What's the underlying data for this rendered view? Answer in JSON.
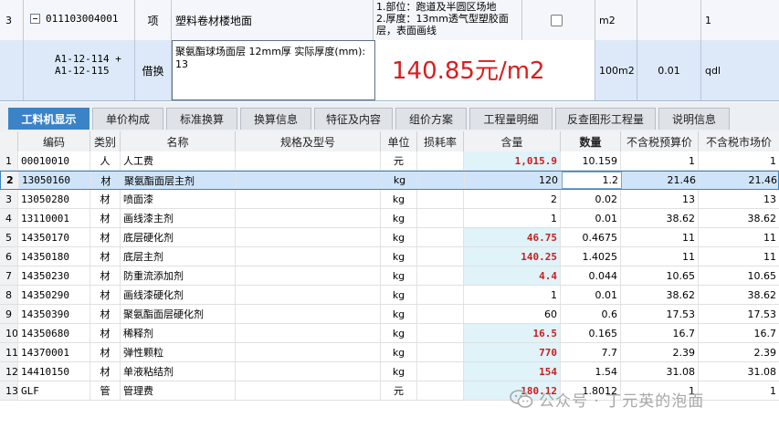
{
  "top_rows": [
    {
      "rownum": "3",
      "code": "011103004001",
      "type": "项",
      "name": "塑料卷材楼地面",
      "feature_lines": [
        "1.部位：跑道及半圆区场地",
        "2.厚度：13mm透气型塑胶面",
        "层，表面画线"
      ],
      "unit": "m2",
      "quantity": "1"
    },
    {
      "code_lines": [
        "A1-12-114 +",
        "A1-12-115"
      ],
      "type": "借换",
      "name_lines": [
        "聚氨酯球场面层 12mm厚  实际厚度(mm):",
        "13"
      ],
      "price": "140.85元/m2",
      "unit": "100m2",
      "quantity": "0.01",
      "extra": "qdl"
    }
  ],
  "tabs": [
    {
      "label": "工料机显示",
      "active": true
    },
    {
      "label": "单价构成"
    },
    {
      "label": "标准换算"
    },
    {
      "label": "换算信息"
    },
    {
      "label": "特征及内容"
    },
    {
      "label": "组价方案"
    },
    {
      "label": "工程量明细"
    },
    {
      "label": "反查图形工程量"
    },
    {
      "label": "说明信息"
    }
  ],
  "columns": {
    "code": "编码",
    "category": "类别",
    "name": "名称",
    "spec": "规格及型号",
    "unit": "单位",
    "loss": "损耗率",
    "content": "含量",
    "quantity": "数量",
    "budget_price": "不含税预算价",
    "market_price": "不含税市场价"
  },
  "rows": [
    {
      "n": "1",
      "code": "00010010",
      "cat": "人",
      "name": "人工费",
      "unit": "元",
      "content": "1,015.9",
      "content_red": true,
      "qty": "10.159",
      "bp": "1",
      "mp": "1"
    },
    {
      "n": "2",
      "code": "13050160",
      "cat": "材",
      "name": "聚氨酯面层主剂",
      "unit": "kg",
      "content": "120",
      "content_red": false,
      "qty": "1.2",
      "bp": "21.46",
      "mp": "21.46",
      "selected": true
    },
    {
      "n": "3",
      "code": "13050280",
      "cat": "材",
      "name": "喷面漆",
      "unit": "kg",
      "content": "2",
      "content_red": false,
      "qty": "0.02",
      "bp": "13",
      "mp": "13"
    },
    {
      "n": "4",
      "code": "13110001",
      "cat": "材",
      "name": "画线漆主剂",
      "unit": "kg",
      "content": "1",
      "content_red": false,
      "qty": "0.01",
      "bp": "38.62",
      "mp": "38.62"
    },
    {
      "n": "5",
      "code": "14350170",
      "cat": "材",
      "name": "底层硬化剂",
      "unit": "kg",
      "content": "46.75",
      "content_red": true,
      "qty": "0.4675",
      "bp": "11",
      "mp": "11"
    },
    {
      "n": "6",
      "code": "14350180",
      "cat": "材",
      "name": "底层主剂",
      "unit": "kg",
      "content": "140.25",
      "content_red": true,
      "qty": "1.4025",
      "bp": "11",
      "mp": "11"
    },
    {
      "n": "7",
      "code": "14350230",
      "cat": "材",
      "name": "防重流添加剂",
      "unit": "kg",
      "content": "4.4",
      "content_red": true,
      "qty": "0.044",
      "bp": "10.65",
      "mp": "10.65"
    },
    {
      "n": "8",
      "code": "14350290",
      "cat": "材",
      "name": "画线漆硬化剂",
      "unit": "kg",
      "content": "1",
      "content_red": false,
      "qty": "0.01",
      "bp": "38.62",
      "mp": "38.62"
    },
    {
      "n": "9",
      "code": "14350390",
      "cat": "材",
      "name": "聚氨酯面层硬化剂",
      "unit": "kg",
      "content": "60",
      "content_red": false,
      "qty": "0.6",
      "bp": "17.53",
      "mp": "17.53"
    },
    {
      "n": "10",
      "code": "14350680",
      "cat": "材",
      "name": "稀释剂",
      "unit": "kg",
      "content": "16.5",
      "content_red": true,
      "qty": "0.165",
      "bp": "16.7",
      "mp": "16.7"
    },
    {
      "n": "11",
      "code": "14370001",
      "cat": "材",
      "name": "弹性颗粒",
      "unit": "kg",
      "content": "770",
      "content_red": true,
      "qty": "7.7",
      "bp": "2.39",
      "mp": "2.39"
    },
    {
      "n": "12",
      "code": "14410150",
      "cat": "材",
      "name": "单液粘结剂",
      "unit": "kg",
      "content": "154",
      "content_red": true,
      "qty": "1.54",
      "bp": "31.08",
      "mp": "31.08"
    },
    {
      "n": "13",
      "code": "GLF",
      "cat": "管",
      "name": "管理费",
      "unit": "元",
      "content": "180.12",
      "content_red": true,
      "qty": "1.8012",
      "bp": "1",
      "mp": "1"
    }
  ],
  "watermark": "公众号 · 丁元英的泡面"
}
